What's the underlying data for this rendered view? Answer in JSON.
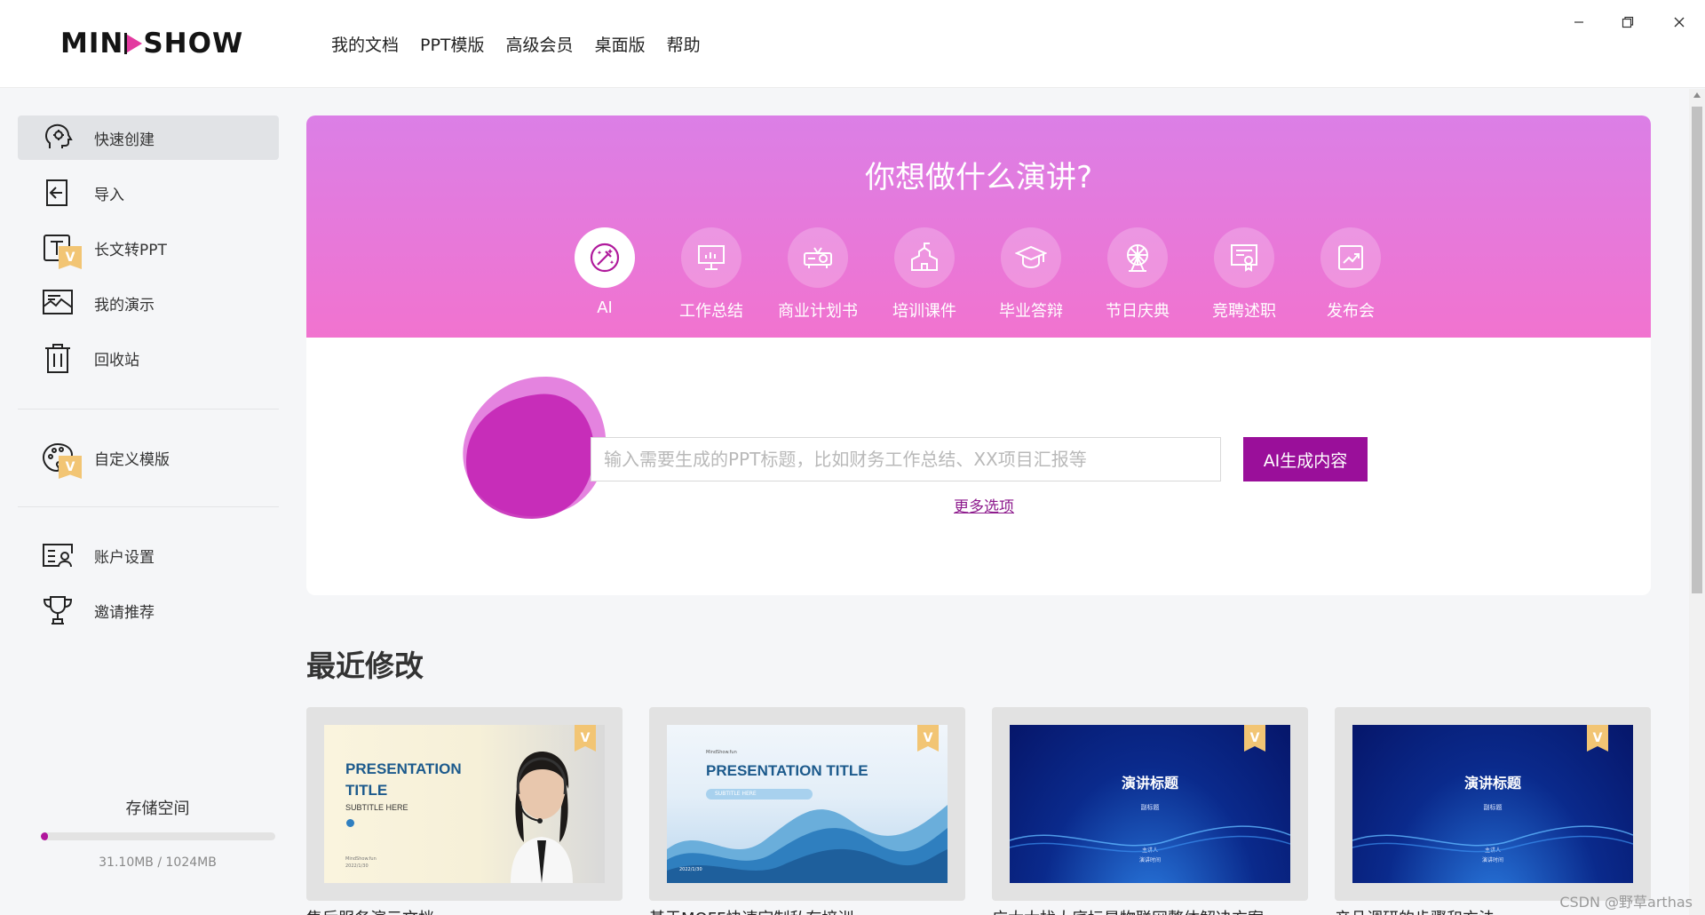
{
  "app": {
    "logo_left": "MIN",
    "logo_right": "SHOW",
    "nav": [
      "我的文档",
      "PPT模版",
      "高级会员",
      "桌面版",
      "帮助"
    ]
  },
  "sidebar": {
    "items": [
      {
        "label": "快速创建",
        "icon": "brain-head-icon"
      },
      {
        "label": "导入",
        "icon": "import-icon"
      },
      {
        "label": "长文转PPT",
        "icon": "text-t-icon",
        "badge": "V"
      },
      {
        "label": "我的演示",
        "icon": "presentation-image-icon"
      },
      {
        "label": "回收站",
        "icon": "trash-icon"
      },
      {
        "label": "自定义模版",
        "icon": "palette-icon",
        "badge": "V"
      },
      {
        "label": "账户设置",
        "icon": "account-card-icon"
      },
      {
        "label": "邀请推荐",
        "icon": "trophy-icon"
      }
    ],
    "storage_title": "存储空间",
    "storage_text": "31.10MB / 1024MB",
    "storage_used_fraction": 0.0304
  },
  "hero": {
    "title": "你想做什么演讲?",
    "categories": [
      {
        "label": "AI",
        "icon": "ai-magic-icon",
        "active": true
      },
      {
        "label": "工作总结",
        "icon": "monitor-chart-icon"
      },
      {
        "label": "商业计划书",
        "icon": "projector-icon"
      },
      {
        "label": "培训课件",
        "icon": "school-building-icon"
      },
      {
        "label": "毕业答辩",
        "icon": "graduation-cap-icon"
      },
      {
        "label": "节日庆典",
        "icon": "ferris-wheel-icon"
      },
      {
        "label": "竞聘述职",
        "icon": "certificate-icon"
      },
      {
        "label": "发布会",
        "icon": "trend-up-icon"
      }
    ],
    "input_placeholder": "输入需要生成的PPT标题，比如财务工作总结、XX项目汇报等",
    "generate_label": "AI生成内容",
    "more_options": "更多选项"
  },
  "recent": {
    "title": "最近修改",
    "items": [
      {
        "name": "售后服务演示文档",
        "slide_title": "PRESENTATION TITLE",
        "slide_subtitle": "SUBTITLE HERE",
        "slide_brand": "MindShow.fun",
        "slide_date": "2022/1/30",
        "badge": "V"
      },
      {
        "name": "基于MOFF快速定制私有培训",
        "slide_title": "PRESENTATION TITLE",
        "slide_subtitle": "SUBTITLE HERE",
        "slide_brand": "MindShow.fun",
        "slide_date": "2022/1/30",
        "badge": "V"
      },
      {
        "name": "广太太找大底坛是物联网整体解决方案",
        "slide_title": "演讲标题",
        "slide_subtitle": "副标题",
        "slide_speaker": "主讲人",
        "slide_time": "演讲时间",
        "badge": "V"
      },
      {
        "name": "产品调研的步骤和方法",
        "slide_title": "演讲标题",
        "slide_subtitle": "副标题",
        "slide_speaker": "主讲人",
        "slide_time": "演讲时间",
        "badge": "V"
      }
    ]
  },
  "watermark": "CSDN @野草arthas",
  "colors": {
    "accent": "#9a0f9a",
    "hero_gradient_top": "#db7fe6",
    "hero_gradient_bottom": "#f173cf"
  }
}
